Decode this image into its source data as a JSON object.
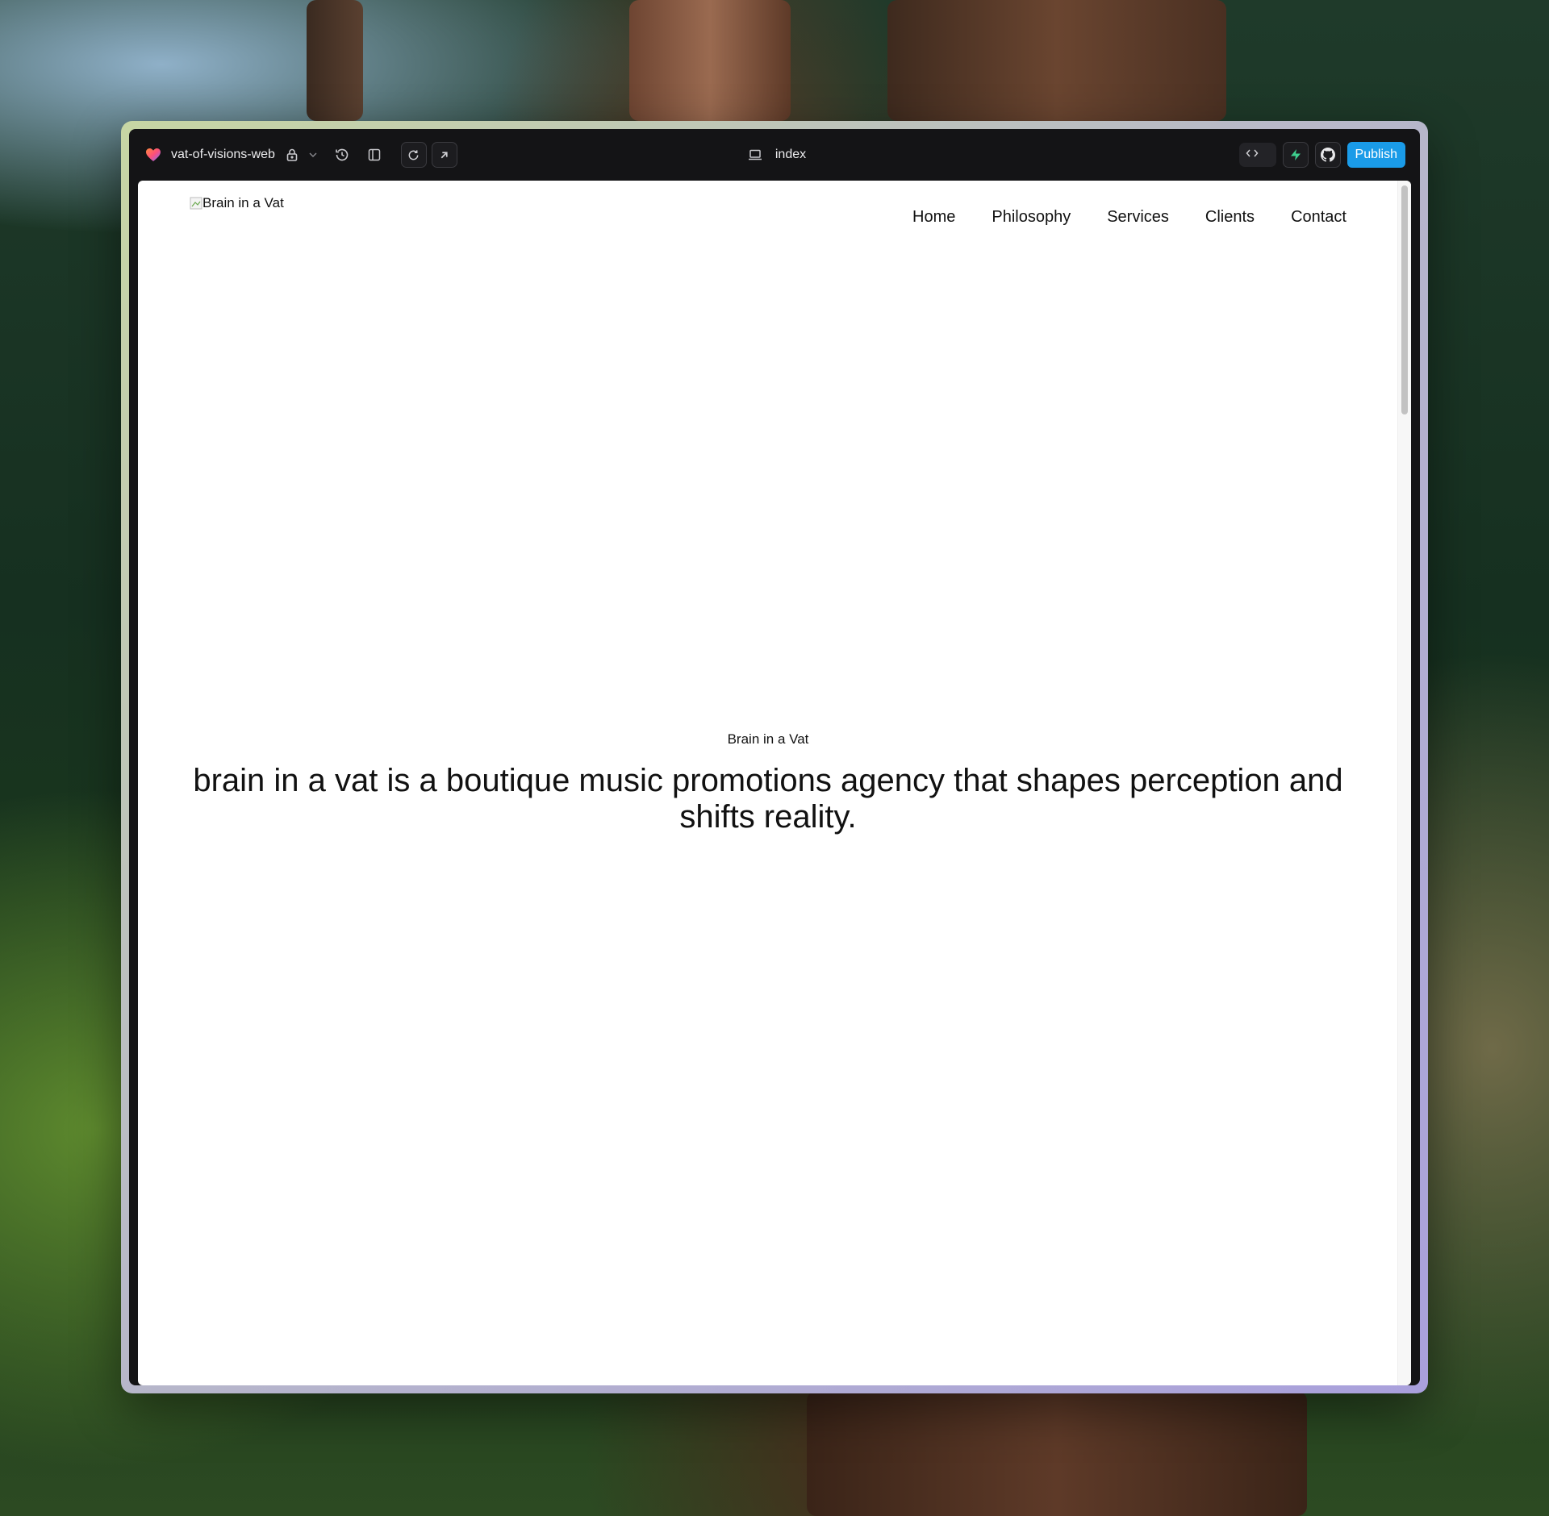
{
  "editor": {
    "project_name": "vat-of-visions-web",
    "page_label": "index",
    "publish_label": "Publish",
    "colors": {
      "publish": "#1a9be8",
      "supabase": "#3ecf8e",
      "toolbar_bg": "#141416"
    }
  },
  "site": {
    "logo_alt": "Brain in a Vat",
    "nav": [
      "Home",
      "Philosophy",
      "Services",
      "Clients",
      "Contact"
    ],
    "hero": {
      "eyebrow": "Brain in a Vat",
      "headline": "brain in a vat is a boutique music promotions agency that shapes perception and shifts reality."
    }
  },
  "icons": {
    "project": "heart-logo-icon",
    "lock": "lock-icon",
    "dropdown": "chevron-down-icon",
    "history": "history-icon",
    "sidebar": "sidebar-toggle-icon",
    "refresh": "refresh-icon",
    "open_external": "external-link-icon",
    "device": "laptop-icon",
    "code": "code-icon",
    "supabase": "supabase-icon",
    "github": "github-icon"
  }
}
